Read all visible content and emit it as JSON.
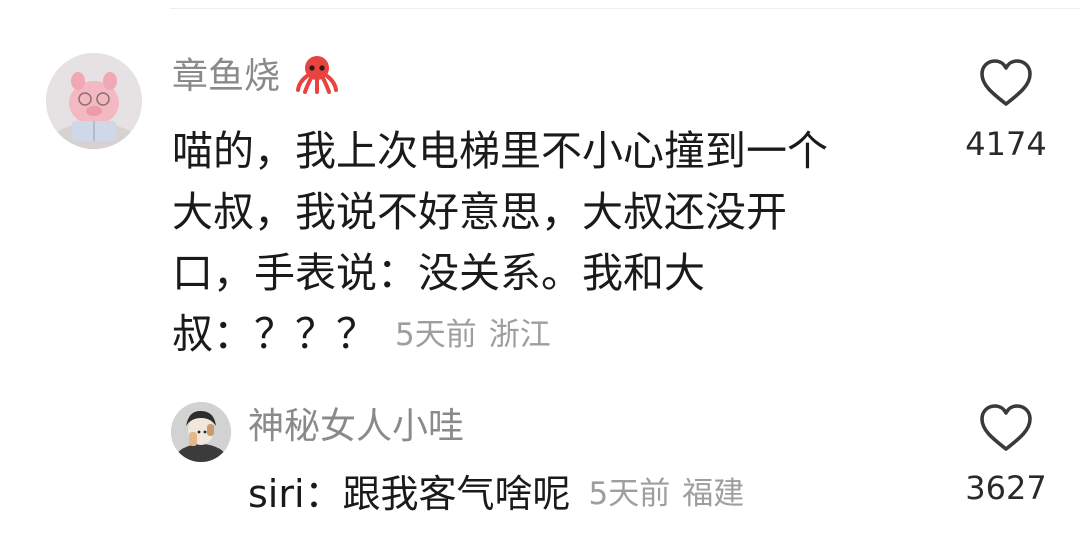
{
  "comment": {
    "username": "章鱼烧",
    "username_emoji": "octopus-emoji",
    "lines": [
      "喵的，我上次电梯里不小心撞到一个",
      "大叔，我说不好意思，大叔还没开",
      "口，手表说：没关系。我和大",
      "叔：？？？"
    ],
    "time": "5天前",
    "location": "浙江",
    "likes": "4174"
  },
  "reply": {
    "username": "神秘女人小哇",
    "text": "siri：跟我客气啥呢",
    "time": "5天前",
    "location": "福建",
    "likes": "3627"
  },
  "icons": {
    "like": "heart-outline-icon"
  },
  "colors": {
    "username": "#8a8a8a",
    "text": "#1a1a1a",
    "meta": "#9e9e9e",
    "octopus": "#e8433f"
  }
}
